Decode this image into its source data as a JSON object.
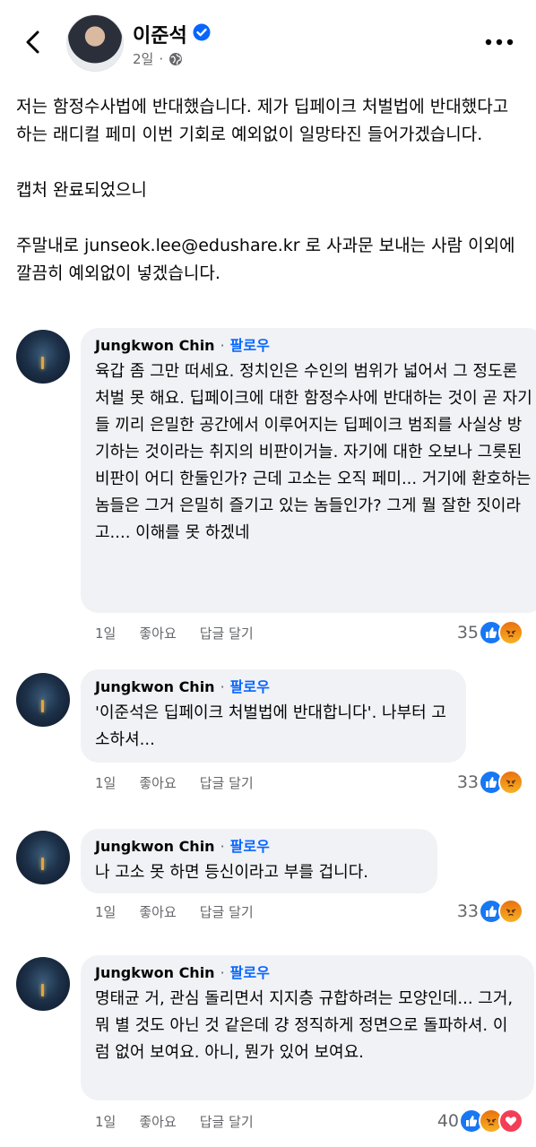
{
  "header": {
    "name": "이준석",
    "time": "2일",
    "separator": "·"
  },
  "post": {
    "paragraphs": [
      "저는 함정수사법에 반대했습니다. 제가 딥페이크 처벌법에 반대했다고 하는 래디컬 페미 이번 기회로 예외없이 일망타진 들어가겠습니다.",
      "캡처 완료되었으니",
      "주말내로 junseok.lee@edushare.kr 로 사과문 보내는 사람 이외에 깔끔히 예외없이 넣겠습니다."
    ]
  },
  "comments": [
    {
      "author": "Jungkwon Chin",
      "dot": "·",
      "follow": "팔로우",
      "text": "육갑 좀 그만 떠세요. 정치인은 수인의 범위가 넓어서 그 정도론 처벌 못 해요. 딥페이크에 대한 함정수사에 반대하는 것이 곧 자기들 끼리 은밀한 공간에서 이루어지는 딥페이크 범죄를 사실상 방기하는 것이라는 취지의 비판이거늘. 자기에 대한 오보나 그릇된 비판이 어디 한둘인가? 근데 고소는 오직 페미... 거기에 환호하는 놈들은 그거 은밀히 즐기고 있는 놈들인가? 그게 뭘 잘한 짓이라고.... 이해를 못 하겠네",
      "time": "1일",
      "like": "좋아요",
      "reply": "답글 달기",
      "count": "35"
    },
    {
      "author": "Jungkwon Chin",
      "dot": "·",
      "follow": "팔로우",
      "text": "'이준석은 딥페이크 처벌법에 반대합니다'. 나부터 고소하셔...",
      "time": "1일",
      "like": "좋아요",
      "reply": "답글 달기",
      "count": "33"
    },
    {
      "author": "Jungkwon Chin",
      "dot": "·",
      "follow": "팔로우",
      "text": "나 고소 못 하면 등신이라고 부를 겁니다.",
      "time": "1일",
      "like": "좋아요",
      "reply": "답글 달기",
      "count": "33"
    },
    {
      "author": "Jungkwon Chin",
      "dot": "·",
      "follow": "팔로우",
      "text": "명태균 거, 관심 돌리면서 지지층 규합하려는 모양인데... 그거, 뭐 별 것도 아닌 것 같은데 걍 정직하게 정면으로 돌파하셔. 이럼 없어 보여요. 아니, 뭔가 있어 보여요.",
      "time": "1일",
      "like": "좋아요",
      "reply": "답글 달기",
      "count": "40"
    }
  ],
  "icons": {
    "back": "chevron-left-icon",
    "verified": "verified-badge-icon",
    "globe": "globe-icon",
    "more": "more-horizontal-icon",
    "reactions": [
      "like-reaction-icon",
      "angry-reaction-icon",
      "love-reaction-icon"
    ]
  },
  "colors": {
    "accent": "#0866ff",
    "like": "#1877f2",
    "angry": "#f7b125",
    "love": "#f33e58",
    "bubble": "#f0f2f5",
    "meta": "#65676b"
  }
}
